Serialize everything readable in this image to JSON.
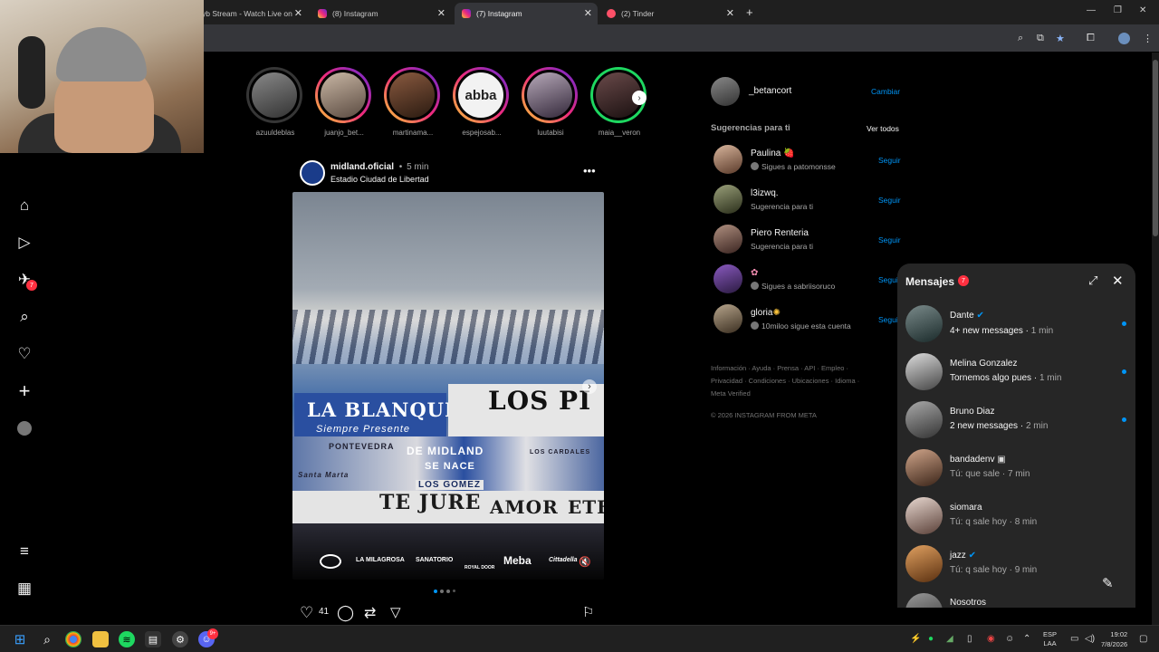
{
  "browser": {
    "tabs": [
      {
        "label": "yb Stream - Watch Live on",
        "active": false
      },
      {
        "label": "(8) Instagram",
        "active": false
      },
      {
        "label": "(7) Instagram",
        "active": true
      },
      {
        "label": "(2) Tinder",
        "active": false
      }
    ],
    "new_tab": "+"
  },
  "nav": {
    "notifications_badge": "7"
  },
  "stories": [
    {
      "name": "azuuldeblas",
      "ring": "seen"
    },
    {
      "name": "juanjo_bet...",
      "ring": "new"
    },
    {
      "name": "martinama...",
      "ring": "new"
    },
    {
      "name": "espejosab...",
      "ring": "new",
      "logo_text": "abba"
    },
    {
      "name": "luutabisi",
      "ring": "new"
    },
    {
      "name": "maia__veron",
      "ring": "close"
    }
  ],
  "post": {
    "author": "midland.oficial",
    "time": "5 min",
    "separator": "•",
    "location": "Estadio Ciudad de Libertad",
    "image_banners": [
      "LA BLANQUITA",
      "Siempre Presente",
      "LOS PI",
      "DE MIDLAND",
      "SE NACE",
      "LOS GOMEZ",
      "LOS CARDALES",
      "TE JURE",
      "AMOR",
      "ETE",
      "Santa Marta",
      "PONTEVEDRA"
    ],
    "sponsors": [
      "LA MILAGROSA",
      "SANATORIO",
      "ROYAL DOOR",
      "Meba",
      "Cittadella"
    ],
    "likes": "41"
  },
  "sidebar": {
    "account": {
      "username": "_betancort",
      "switch": "Cambiar"
    },
    "suggestions_title": "Sugerencias para ti",
    "see_all": "Ver todos",
    "follow_label": "Seguir",
    "suggestions": [
      {
        "name": "Paulina",
        "sub": "Sigues a patomonsse"
      },
      {
        "name": "l3izwq.",
        "sub": "Sugerencia para ti"
      },
      {
        "name": "Piero Renteria",
        "sub": "Sugerencia para ti"
      },
      {
        "name": "",
        "sub": "Sigues a sabriisoruco"
      },
      {
        "name": "gloria",
        "sub": "10miloo sigue esta cuenta"
      }
    ],
    "footer_line1": "Información · Ayuda · Prensa · API · Empleo ·",
    "footer_line2": "Privacidad · Condiciones · Ubicaciones · Idioma ·",
    "footer_line3": "Meta Verified",
    "copyright": "© 2026 INSTAGRAM FROM META"
  },
  "messages": {
    "title": "Mensajes",
    "badge": "7",
    "threads": [
      {
        "name": "Dante",
        "verified": true,
        "preview": "4+ new messages",
        "time": "1 min",
        "unread": true
      },
      {
        "name": "Melina Gonzalez",
        "verified": false,
        "preview": "Tornemos algo pues",
        "time": "1 min",
        "unread": true
      },
      {
        "name": "Bruno Diaz",
        "verified": false,
        "preview": "2 new messages",
        "time": "2 min",
        "unread": true
      },
      {
        "name": "bandadenv",
        "verified": false,
        "preview": "Tú: que sale",
        "time": "7 min",
        "unread": false
      },
      {
        "name": "siomara",
        "verified": false,
        "preview": "Tú: q sale hoy",
        "time": "8 min",
        "unread": false
      },
      {
        "name": "jazz",
        "verified": true,
        "preview": "Tú: q sale hoy",
        "time": "9 min",
        "unread": false
      },
      {
        "name": "Nosotros",
        "verified": false,
        "preview": "",
        "time": "",
        "unread": false
      }
    ]
  },
  "taskbar": {
    "lang1": "ESP",
    "lang2": "LAA",
    "time": "19:02",
    "date": "7/8/2026",
    "discord_badge": "9+"
  },
  "colors": {
    "accent": "#0095f6",
    "badge": "#ff3040",
    "panel": "#262626"
  }
}
